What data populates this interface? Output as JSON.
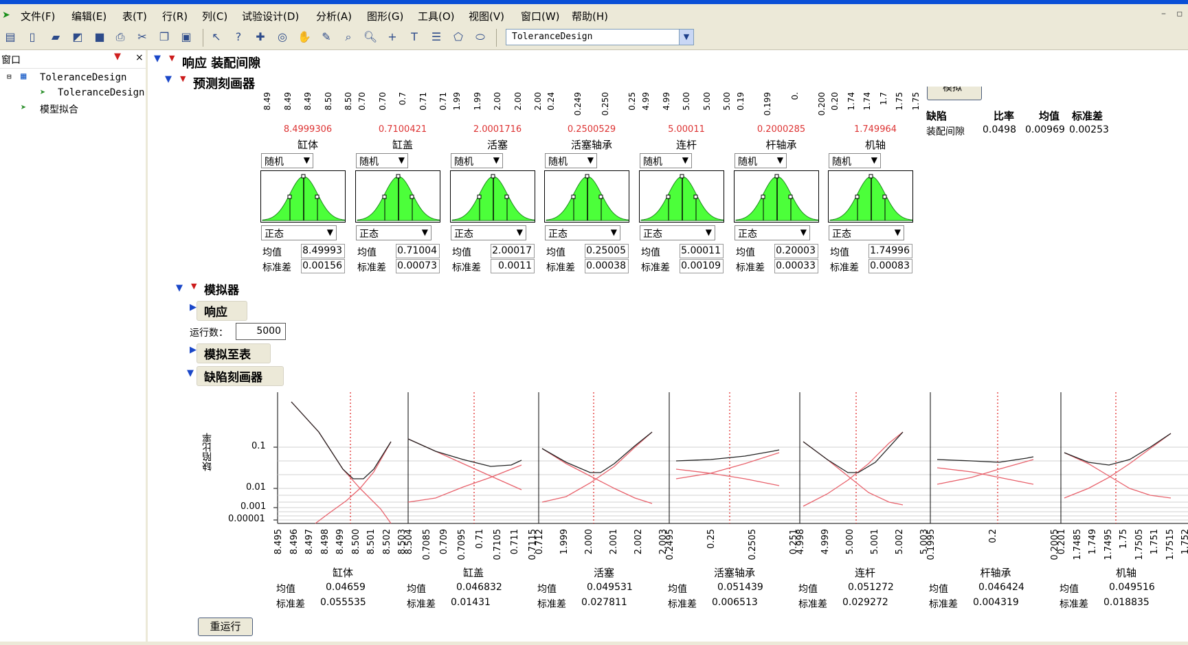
{
  "menu": {
    "items": [
      "文件(F)",
      "编辑(E)",
      "表(T)",
      "行(R)",
      "列(C)",
      "试验设计(D)",
      "分析(A)",
      "图形(G)",
      "工具(O)",
      "视图(V)",
      "窗口(W)",
      "帮助(H)"
    ]
  },
  "toolbar": {
    "combo_value": "ToleranceDesign"
  },
  "left_pane": {
    "title": "窗口",
    "tree": [
      "ToleranceDesign",
      "ToleranceDesign",
      "模型拟合"
    ]
  },
  "report": {
    "response_title": "响应 装配间隙",
    "profiler_title": "预测刻画器",
    "simulate_button": "模拟",
    "factors": [
      {
        "name": "缸体",
        "current": "8.4999306",
        "dist_type": "随机",
        "dist": "正态",
        "mean": "8.49993",
        "sd": "0.00156",
        "ticks": [
          "8.49",
          "8.49",
          "8.49",
          "8.50",
          "8.50"
        ]
      },
      {
        "name": "缸盖",
        "current": "0.7100421",
        "dist_type": "随机",
        "dist": "正态",
        "mean": "0.71004",
        "sd": "0.00073",
        "ticks": [
          "0.70",
          "0.70",
          "0.7",
          "0.71",
          "0.71"
        ]
      },
      {
        "name": "活塞",
        "current": "2.0001716",
        "dist_type": "随机",
        "dist": "正态",
        "mean": "2.00017",
        "sd": "0.0011",
        "ticks": [
          "1.99",
          "1.99",
          "2.00",
          "2.00",
          "2.00"
        ]
      },
      {
        "name": "活塞轴承",
        "current": "0.2500529",
        "dist_type": "随机",
        "dist": "正态",
        "mean": "0.25005",
        "sd": "0.00038",
        "ticks": [
          "0.24",
          "0.249",
          "0.250",
          "0.25"
        ]
      },
      {
        "name": "连杆",
        "current": "5.00011",
        "dist_type": "随机",
        "dist": "正态",
        "mean": "5.00011",
        "sd": "0.00109",
        "ticks": [
          "4.99",
          "4.99",
          "5.00",
          "5.00",
          "5.00"
        ]
      },
      {
        "name": "杆轴承",
        "current": "0.2000285",
        "dist_type": "随机",
        "dist": "正态",
        "mean": "0.20003",
        "sd": "0.00033",
        "ticks": [
          "0.19",
          "0.199",
          "0.",
          "0.200"
        ]
      },
      {
        "name": "机轴",
        "current": "1.749964",
        "dist_type": "随机",
        "dist": "正态",
        "mean": "1.74996",
        "sd": "0.00083",
        "ticks": [
          "0.20",
          "1.74",
          "1.74",
          "1.7",
          "1.75",
          "1.75"
        ]
      }
    ],
    "mean_label": "均值",
    "sd_label": "标准差",
    "defect_table": {
      "headers": [
        "缺陷",
        "比率",
        "均值",
        "标准差"
      ],
      "row": [
        "装配间隙",
        "0.0498",
        "0.00969",
        "0.00253"
      ]
    },
    "simulator_title": "模拟器",
    "sim_response": "响应",
    "runs_label": "运行数：",
    "runs_value": "5000",
    "simulate_to_table": "模拟至表",
    "defect_profiler_title": "缺陷刻画器",
    "y_axis_label": "缺陷比率",
    "y_ticks": [
      "0.1",
      "0.01",
      "0.001",
      "0.00001"
    ],
    "panels": [
      {
        "name": "缸体",
        "mean": "0.04659",
        "sd": "0.055535",
        "ticks": [
          "8.495",
          "8.496",
          "8.497",
          "8.498",
          "8.499",
          "8.500",
          "8.501",
          "8.502",
          "8.503"
        ]
      },
      {
        "name": "缸盖",
        "mean": "0.046832",
        "sd": "0.01431",
        "ticks": [
          "8.504",
          "0.7085",
          "0.709",
          "0.7095",
          "0.71",
          "0.7105",
          "0.711",
          "0.7115"
        ]
      },
      {
        "name": "活塞",
        "mean": "0.049531",
        "sd": "0.027811",
        "ticks": [
          "0.712",
          "1.999",
          "2.000",
          "2.001",
          "2.002",
          "2.003"
        ]
      },
      {
        "name": "活塞轴承",
        "mean": "0.051439",
        "sd": "0.006513",
        "ticks": [
          "0.2495",
          "0.25",
          "0.2505",
          "0.251"
        ]
      },
      {
        "name": "连杆",
        "mean": "0.051272",
        "sd": "0.029272",
        "ticks": [
          "4.998",
          "4.999",
          "5.000",
          "5.001",
          "5.002",
          "5.003"
        ]
      },
      {
        "name": "杆轴承",
        "mean": "0.046424",
        "sd": "0.004319",
        "ticks": [
          "0.1995",
          "0.2",
          "0.2005"
        ]
      },
      {
        "name": "机轴",
        "mean": "0.049516",
        "sd": "0.018835",
        "ticks": [
          "0.201",
          "1.7485",
          "1.749",
          "1.7495",
          "1.75",
          "1.7505",
          "1.751",
          "1.7515",
          "1.752"
        ]
      }
    ],
    "rerun_button": "重运行"
  }
}
